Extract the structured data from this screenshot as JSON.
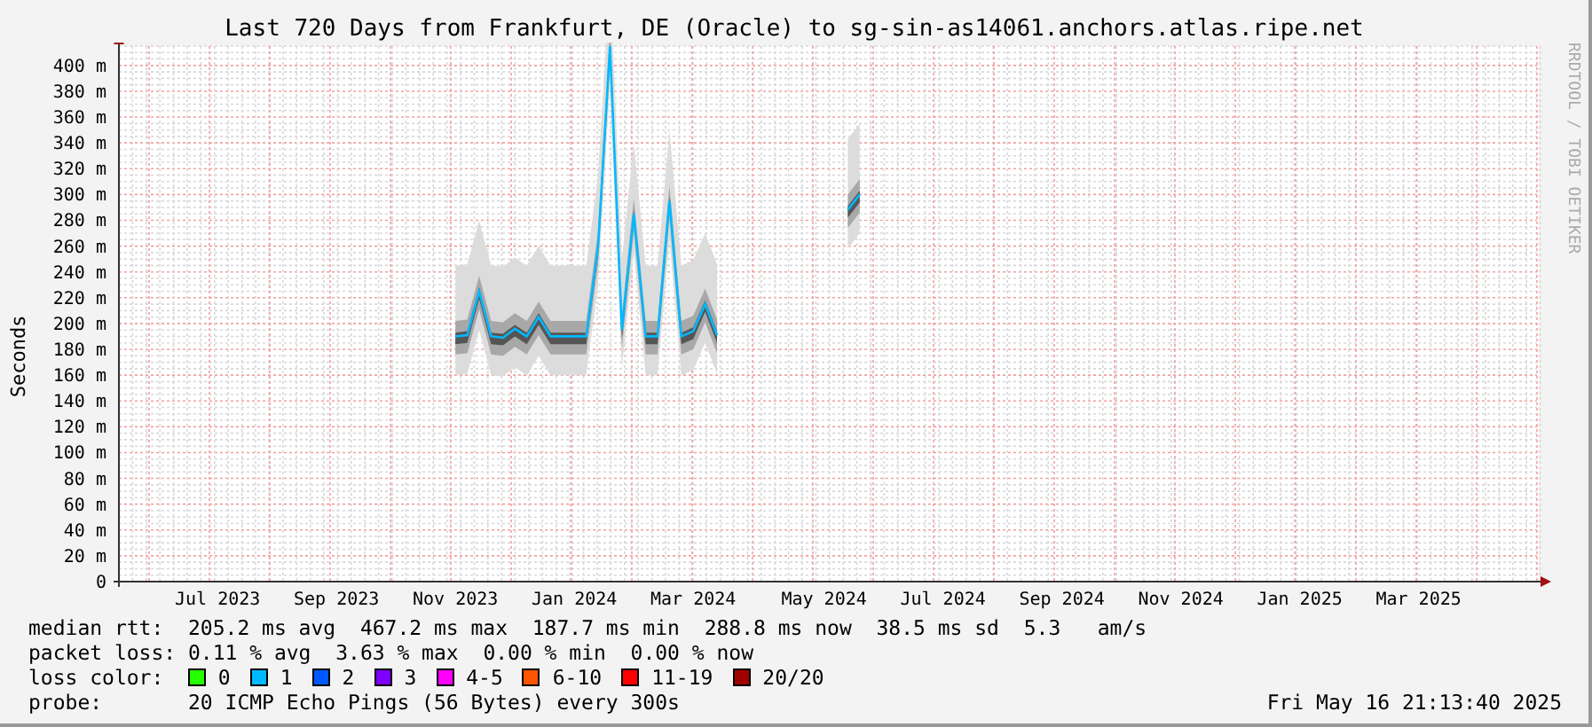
{
  "title": "Last 720 Days from Frankfurt, DE (Oracle) to sg-sin-as14061.anchors.atlas.ripe.net",
  "credit": "RRDTOOL / TOBI OETIKER",
  "chart": {
    "chart_data": {
      "type": "line",
      "ylabel": "Seconds",
      "ylim": [
        0,
        415
      ],
      "grid": true,
      "yticks": [
        {
          "value": 0,
          "label": "0"
        },
        {
          "value": 20,
          "label": "20 m"
        },
        {
          "value": 40,
          "label": "40 m"
        },
        {
          "value": 60,
          "label": "60 m"
        },
        {
          "value": 80,
          "label": "80 m"
        },
        {
          "value": 100,
          "label": "100 m"
        },
        {
          "value": 120,
          "label": "120 m"
        },
        {
          "value": 140,
          "label": "140 m"
        },
        {
          "value": 160,
          "label": "160 m"
        },
        {
          "value": 180,
          "label": "180 m"
        },
        {
          "value": 200,
          "label": "200 m"
        },
        {
          "value": 220,
          "label": "220 m"
        },
        {
          "value": 240,
          "label": "240 m"
        },
        {
          "value": 260,
          "label": "260 m"
        },
        {
          "value": 280,
          "label": "280 m"
        },
        {
          "value": 300,
          "label": "300 m"
        },
        {
          "value": 320,
          "label": "320 m"
        },
        {
          "value": 340,
          "label": "340 m"
        },
        {
          "value": 360,
          "label": "360 m"
        },
        {
          "value": 380,
          "label": "380 m"
        },
        {
          "value": 400,
          "label": "400 m"
        }
      ],
      "categories": [
        null,
        null,
        null,
        null,
        null,
        null,
        null,
        null,
        "Jul 2023",
        null,
        null,
        null,
        null,
        null,
        null,
        null,
        null,
        null,
        "Sep 2023",
        null,
        null,
        null,
        null,
        null,
        null,
        null,
        null,
        null,
        "Nov 2023",
        null,
        null,
        null,
        null,
        null,
        null,
        null,
        null,
        null,
        "Jan 2024",
        null,
        null,
        null,
        null,
        null,
        null,
        null,
        null,
        null,
        "Mar 2024",
        null,
        null,
        null,
        null,
        null,
        null,
        null,
        null,
        null,
        null,
        "May 2024",
        null,
        null,
        null,
        null,
        null,
        null,
        null,
        null,
        null,
        "Jul 2024",
        null,
        null,
        null,
        null,
        null,
        null,
        null,
        null,
        null,
        "Sep 2024",
        null,
        null,
        null,
        null,
        null,
        null,
        null,
        null,
        null,
        "Nov 2024",
        null,
        null,
        null,
        null,
        null,
        null,
        null,
        null,
        null,
        "Jan 2025",
        null,
        null,
        null,
        null,
        null,
        null,
        null,
        null,
        null,
        "Mar 2025",
        null,
        null,
        null,
        null,
        null,
        null,
        null,
        null,
        null,
        null
      ],
      "series": [
        {
          "color": "#00b8ff",
          "values": [
            null,
            null,
            null,
            null,
            null,
            null,
            null,
            null,
            null,
            null,
            null,
            null,
            null,
            null,
            null,
            null,
            null,
            null,
            null,
            null,
            null,
            null,
            null,
            null,
            null,
            null,
            null,
            null,
            190,
            191,
            225,
            190,
            189,
            196,
            190,
            205,
            190,
            190,
            190,
            190,
            260,
            415,
            195,
            285,
            190,
            190,
            295,
            190,
            194,
            215,
            191,
            null,
            null,
            null,
            null,
            null,
            null,
            null,
            null,
            null,
            null,
            288,
            300,
            null,
            null,
            null,
            null,
            null,
            null,
            null,
            null,
            null,
            null,
            null,
            null,
            null,
            null,
            null,
            null,
            null,
            null,
            null,
            null,
            null,
            null,
            null,
            null,
            null,
            null,
            null,
            null,
            null,
            null,
            null,
            null,
            null,
            null,
            null,
            null,
            null,
            null,
            null,
            null,
            null,
            null,
            null,
            null,
            null,
            null,
            null,
            null,
            null,
            null,
            null,
            null,
            null,
            null,
            null,
            null,
            null
          ]
        }
      ]
    }
  },
  "legend": {
    "rows": [
      {
        "kind": "stats",
        "label": "median rtt:",
        "items": [
          "205.2 ms avg",
          "467.2 ms max",
          "187.7 ms min",
          "288.8 ms now",
          "38.5 ms sd",
          "5.3   am/s"
        ]
      },
      {
        "kind": "stats",
        "label": "packet loss:",
        "items": [
          "0.11 % avg",
          "3.63 % max",
          "0.00 % min",
          "0.00 % now"
        ]
      },
      {
        "kind": "colors",
        "label": "loss color:",
        "items": [
          {
            "label": "0",
            "color": "#26ff00"
          },
          {
            "label": "1",
            "color": "#00b8ff"
          },
          {
            "label": "2",
            "color": "#0059ff"
          },
          {
            "label": "3",
            "color": "#7e00ff"
          },
          {
            "label": "4-5",
            "color": "#ff00fe"
          },
          {
            "label": "6-10",
            "color": "#ff5500"
          },
          {
            "label": "11-19",
            "color": "#ff0000"
          },
          {
            "label": "20/20",
            "color": "#a10000"
          }
        ]
      },
      {
        "kind": "probe",
        "label": "probe:",
        "text": "20 ICMP Echo Pings (56 Bytes) every 300s",
        "timestamp": "Fri May 16 21:13:40 2025"
      }
    ]
  }
}
